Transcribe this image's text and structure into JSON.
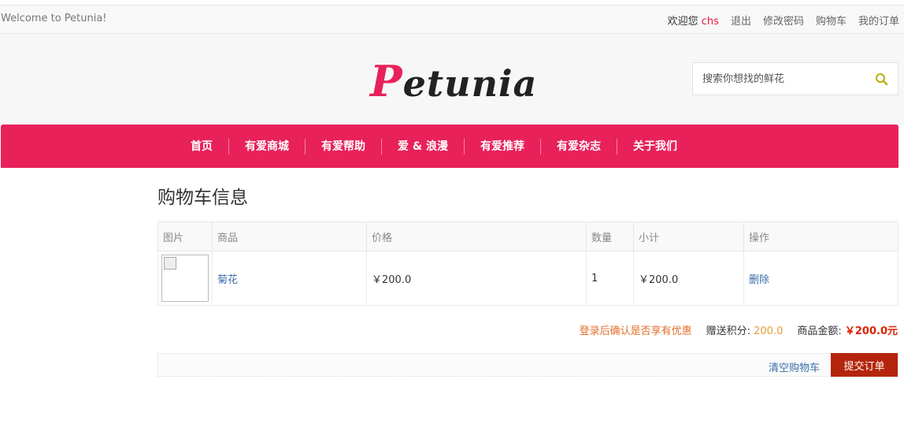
{
  "topbar": {
    "welcome": "Welcome to Petunia!",
    "greeting": "欢迎您",
    "username": "chs",
    "links": [
      "退出",
      "修改密码",
      "购物车",
      "我的订单"
    ]
  },
  "header": {
    "logo_initial": "P",
    "logo_rest": "etunia",
    "search_placeholder": "搜索你想找的鲜花"
  },
  "nav": {
    "items": [
      "首页",
      "有爱商城",
      "有爱帮助",
      "爱 & 浪漫",
      "有爱推荐",
      "有爱杂志",
      "关于我们"
    ]
  },
  "cart": {
    "title": "购物车信息",
    "headers": [
      "图片",
      "商品",
      "价格",
      "数量",
      "小计",
      "操作"
    ],
    "rows": [
      {
        "product": "菊花",
        "price": "￥200.0",
        "qty": "1",
        "subtotal": "￥200.0",
        "action": "删除"
      }
    ],
    "login_note": "登录后确认是否享有优惠",
    "points_label": "赠送积分:",
    "points_value": "200.0",
    "amount_label": "商品金额:",
    "amount_value": "￥200.0元",
    "clear_label": "清空购物车",
    "submit_label": "提交订单"
  },
  "colors": {
    "brand": "#e8215b",
    "submit": "#b5250c",
    "link": "#3a6fa8"
  },
  "icons": {
    "search": "search-icon"
  }
}
